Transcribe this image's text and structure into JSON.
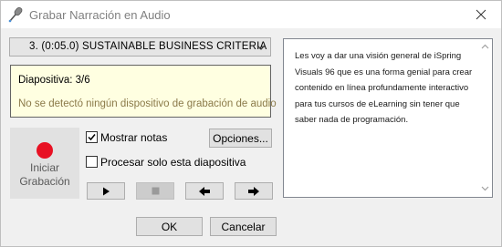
{
  "window": {
    "title": "Grabar Narración en Audio",
    "title_icon": "microphone-icon",
    "close_icon": "close-icon"
  },
  "slide_selector": {
    "selected": "3. (0:05.0) SUSTAINABLE BUSINESS CRITERIA",
    "arrow_icon": "chevron-down-icon"
  },
  "info": {
    "slide_label": "Diapositiva: 3/6",
    "message": "No se detectó ningún dispositivo de grabación de audio"
  },
  "record": {
    "label": "Iniciar Grabación",
    "icon": "record-dot-icon",
    "color": "#e81123"
  },
  "options": {
    "show_notes_label": "Mostrar notas",
    "show_notes_checked": true,
    "this_slide_only_label": "Procesar solo esta diapositiva",
    "this_slide_only_checked": false,
    "options_button": "Opciones..."
  },
  "transport": {
    "play_icon": "play-icon",
    "stop_icon": "stop-icon",
    "prev_icon": "arrow-left-icon",
    "next_icon": "arrow-right-icon"
  },
  "notes": {
    "text": "Les voy a dar una visión general de iSpring Visuals 96 que es una forma genial para crear contenido en línea profundamente interactivo para tus cursos de eLearning sin tener que saber nada de programación."
  },
  "footer": {
    "ok": "OK",
    "cancel": "Cancelar"
  }
}
